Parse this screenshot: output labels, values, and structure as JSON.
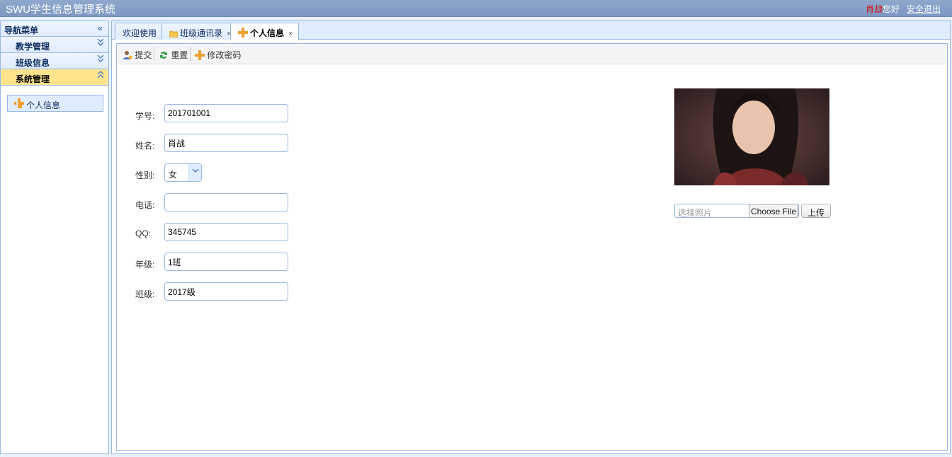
{
  "header": {
    "app_title": "SWU学生信息管理系统",
    "user_name": "肖战",
    "greeting": "您好",
    "logout": "安全退出"
  },
  "sidebar": {
    "title": "导航菜单",
    "sections": [
      {
        "label": "教学管理",
        "expanded": false
      },
      {
        "label": "班级信息",
        "expanded": false
      },
      {
        "label": "系统管理",
        "expanded": true
      }
    ],
    "menu_item": "个人信息"
  },
  "tabs": [
    {
      "label": "欢迎使用",
      "closable": false
    },
    {
      "label": "班级通讯录",
      "closable": true,
      "icon": "folder-icon"
    },
    {
      "label": "个人信息",
      "closable": true,
      "icon": "puzzle-icon",
      "selected": true
    }
  ],
  "close_glyph": "×",
  "toolbar": {
    "submit": "提交",
    "reset": "重置",
    "change_password": "修改密码"
  },
  "form": {
    "student_id_label": "学号:",
    "student_id": "201701001",
    "name_label": "姓名:",
    "name": "肖战",
    "gender_label": "性别:",
    "gender": "女",
    "phone_label": "电话:",
    "phone": "",
    "qq_label": "QQ:",
    "qq": "345745",
    "grade_label": "年级:",
    "grade": "1班",
    "class_label": "班级:",
    "class": "2017级"
  },
  "upload": {
    "placeholder": "选择照片",
    "choose_file": "Choose File",
    "upload_button": "上传"
  },
  "colors": {
    "header": "#7c98c3",
    "border": "#95b8e7",
    "active_section": "#ffe48d",
    "username": "#e00000"
  }
}
